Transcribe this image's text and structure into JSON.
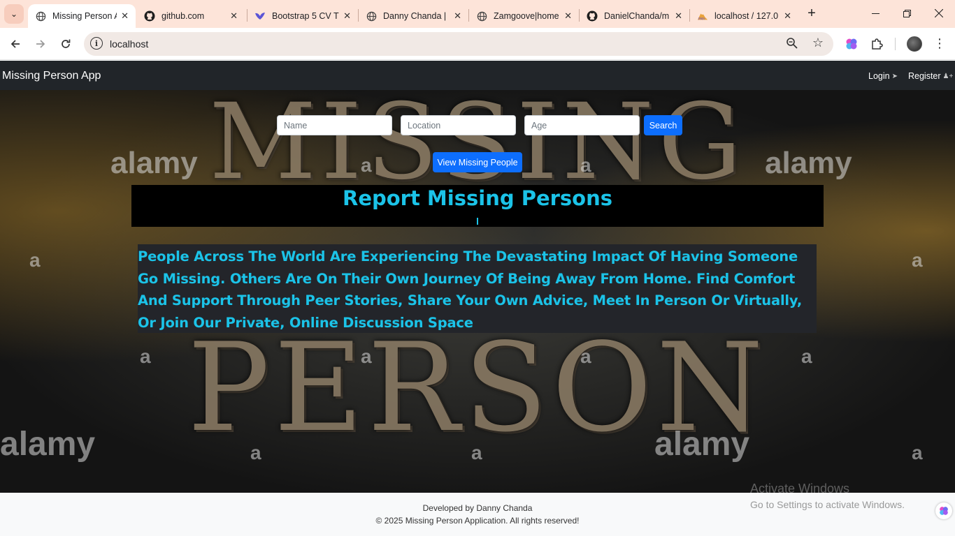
{
  "browser": {
    "tabs": [
      {
        "title": "Missing Person A",
        "icon": "globe-icon",
        "active": true
      },
      {
        "title": "github.com",
        "icon": "github-icon",
        "active": false
      },
      {
        "title": "Bootstrap 5 CV T",
        "icon": "bootstrap-bird-icon",
        "active": false
      },
      {
        "title": "Danny Chanda |",
        "icon": "globe-icon",
        "active": false
      },
      {
        "title": "Zamgoove|home",
        "icon": "globe-icon",
        "active": false
      },
      {
        "title": "DanielChanda/m",
        "icon": "github-icon",
        "active": false
      },
      {
        "title": "localhost / 127.0",
        "icon": "phpmyadmin-icon",
        "active": false
      }
    ],
    "address": "localhost",
    "accent": "#fde4d9"
  },
  "navbar": {
    "brand": "Missing Person App",
    "login": "Login",
    "register": "Register"
  },
  "search": {
    "name_placeholder": "Name",
    "location_placeholder": "Location",
    "age_placeholder": "Age",
    "button": "Search"
  },
  "view_button": "View Missing People",
  "hero": {
    "title": "Report Missing Persons",
    "description": "People Across The World Are Experiencing The Devastating Impact Of Having Someone Go Missing. Others Are On Their Own Journey Of Being Away From Home. Find Comfort And Support Through Peer Stories, Share Your Own Advice, Meet In Person Or Virtually, Or Join Our Private, Online Discussion Space",
    "bg_word_top": "MISSING",
    "bg_word_bottom": "PERSON",
    "watermark": "alamy",
    "watermark_short": "a",
    "title_color": "#1bc3e8"
  },
  "footer": {
    "developer": "Developed by Danny Chanda",
    "copyright": "© 2025 Missing Person Application. All rights reserved!"
  },
  "os_overlay": {
    "activate_title": "Activate Windows",
    "activate_sub": "Go to Settings to activate Windows."
  }
}
